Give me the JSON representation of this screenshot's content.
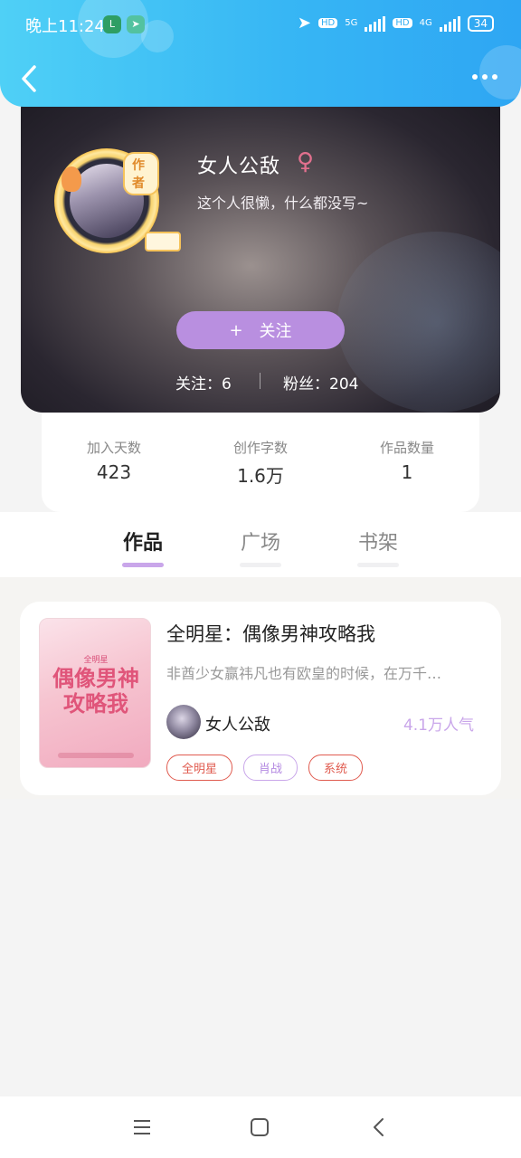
{
  "status_bar": {
    "time": "晚上11:24",
    "hd1": "HD",
    "net1": "5G",
    "hd2": "HD",
    "net2": "4G",
    "battery": "34"
  },
  "header": {
    "back_icon": "chevron-left-icon",
    "more_icon": "more-dots-icon"
  },
  "profile": {
    "avatar_badge": "作者",
    "name": "女人公敌",
    "gender_symbol": "♀",
    "bio": "这个人很懒，什么都没写~",
    "follow_plus": "+",
    "follow_label": "关注",
    "following": "关注：6",
    "fans": "粉丝：204"
  },
  "stats": [
    {
      "label": "加入天数",
      "value": "423"
    },
    {
      "label": "创作字数",
      "value": "1.6万"
    },
    {
      "label": "作品数量",
      "value": "1"
    }
  ],
  "tabs": [
    {
      "label": "作品",
      "active": true
    },
    {
      "label": "广场",
      "active": false
    },
    {
      "label": "书架",
      "active": false
    }
  ],
  "work": {
    "cover_subtitle": "全明星",
    "cover_title": "偶像男神攻略我",
    "title": "全明星：偶像男神攻略我",
    "description": "非酋少女赢祎凡也有欧皇的时候，在万千…",
    "author": "女人公敌",
    "popularity": "4.1万人气",
    "tags": [
      {
        "label": "全明星",
        "color": "#e05b4f"
      },
      {
        "label": "肖战",
        "color": "#b58be2"
      },
      {
        "label": "系统",
        "color": "#e05b4f"
      }
    ]
  },
  "nav": {
    "menu_icon": "menu-icon",
    "home_icon": "home-square-icon",
    "back_icon": "back-triangle-icon"
  }
}
